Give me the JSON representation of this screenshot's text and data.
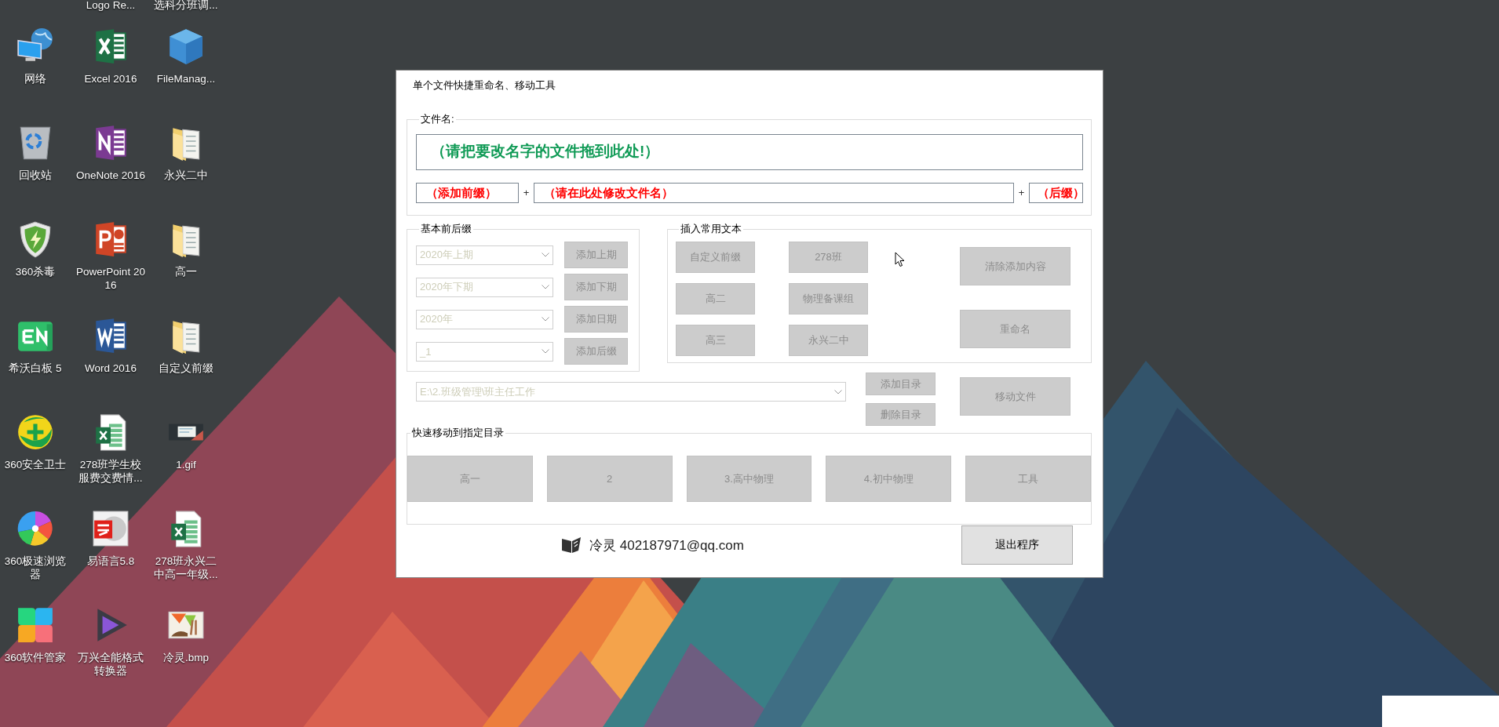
{
  "desktop": {
    "top_labels": [
      {
        "label": "Logo Re..."
      },
      {
        "label": "选科分班调..."
      }
    ],
    "icons": [
      {
        "label": "网络",
        "kind": "network"
      },
      {
        "label": "Excel 2016",
        "kind": "excel"
      },
      {
        "label": "FileManag...",
        "kind": "cube"
      },
      {
        "label": "回收站",
        "kind": "recycle"
      },
      {
        "label": "OneNote 2016",
        "kind": "onenote"
      },
      {
        "label": "永兴二中",
        "kind": "folder"
      },
      {
        "label": "360杀毒",
        "kind": "shield"
      },
      {
        "label": "PowerPoint 2016",
        "kind": "powerpoint"
      },
      {
        "label": "高一",
        "kind": "folder"
      },
      {
        "label": "希沃白板 5",
        "kind": "tile"
      },
      {
        "label": "Word 2016",
        "kind": "word"
      },
      {
        "label": "自定义前缀",
        "kind": "folder"
      },
      {
        "label": "360安全卫士",
        "kind": "plus"
      },
      {
        "label": "278班学生校服费交费情...",
        "kind": "sheetfile"
      },
      {
        "label": "1.gif",
        "kind": "screenshot"
      },
      {
        "label": "360极速浏览器",
        "kind": "swirl"
      },
      {
        "label": "易语言5.8",
        "kind": "seal"
      },
      {
        "label": "278班永兴二中高一年级...",
        "kind": "sheetfile"
      },
      {
        "label": "360软件管家",
        "kind": "flower"
      },
      {
        "label": "万兴全能格式转换器",
        "kind": "play"
      },
      {
        "label": "冷灵.bmp",
        "kind": "painting"
      }
    ]
  },
  "window": {
    "title": "单个文件快捷重命名、移动工具",
    "file_group": {
      "label": "文件名:",
      "drop_hint": "（请把要改名字的文件拖到此处!）",
      "prefix": "（添加前缀）",
      "joiners": [
        "+",
        "+"
      ],
      "name": "（请在此处修改文件名）",
      "suffix": "（后缀）"
    },
    "affix_group": {
      "label": "基本前后缀",
      "rows": [
        {
          "dropdown": {
            "value": "2020年上期",
            "disabled": true
          },
          "button": {
            "label": "添加上期",
            "disabled": true
          }
        },
        {
          "dropdown": {
            "value": "2020年下期",
            "disabled": true
          },
          "button": {
            "label": "添加下期",
            "disabled": true
          }
        },
        {
          "dropdown": {
            "value": "2020年",
            "disabled": true
          },
          "button": {
            "label": "添加日期",
            "disabled": true
          }
        },
        {
          "dropdown": {
            "value": "_1",
            "disabled": true
          },
          "button": {
            "label": "添加后缀",
            "disabled": true
          }
        }
      ]
    },
    "insert_group": {
      "label": "插入常用文本",
      "buttons": [
        {
          "label": "自定义前缀",
          "disabled": true
        },
        {
          "label": "278班",
          "disabled": true
        },
        {
          "label": "高二",
          "disabled": true
        },
        {
          "label": "物理备课组",
          "disabled": true
        },
        {
          "label": "高三",
          "disabled": true
        },
        {
          "label": "永兴二中",
          "disabled": true
        }
      ],
      "side_buttons": [
        {
          "label": "清除添加内容",
          "disabled": true
        },
        {
          "label": "重命名",
          "disabled": true
        }
      ]
    },
    "directory": {
      "dropdown": {
        "value": "E:\\2.班级管理\\班主任工作",
        "disabled": true
      },
      "buttons": [
        {
          "label": "添加目录",
          "disabled": true
        },
        {
          "label": "删除目录",
          "disabled": true
        }
      ],
      "move_button": {
        "label": "移动文件",
        "disabled": true
      }
    },
    "quick_group": {
      "label": "快速移动到指定目录",
      "buttons": [
        {
          "label": "高一",
          "disabled": true
        },
        {
          "label": "2",
          "disabled": true
        },
        {
          "label": "3.高中物理",
          "disabled": true
        },
        {
          "label": "4.初中物理",
          "disabled": true
        },
        {
          "label": "工具",
          "disabled": true
        }
      ]
    },
    "footer": {
      "credit": "冷灵 402187971@qq.com",
      "exit_button": {
        "label": "退出程序",
        "disabled": false
      }
    }
  }
}
